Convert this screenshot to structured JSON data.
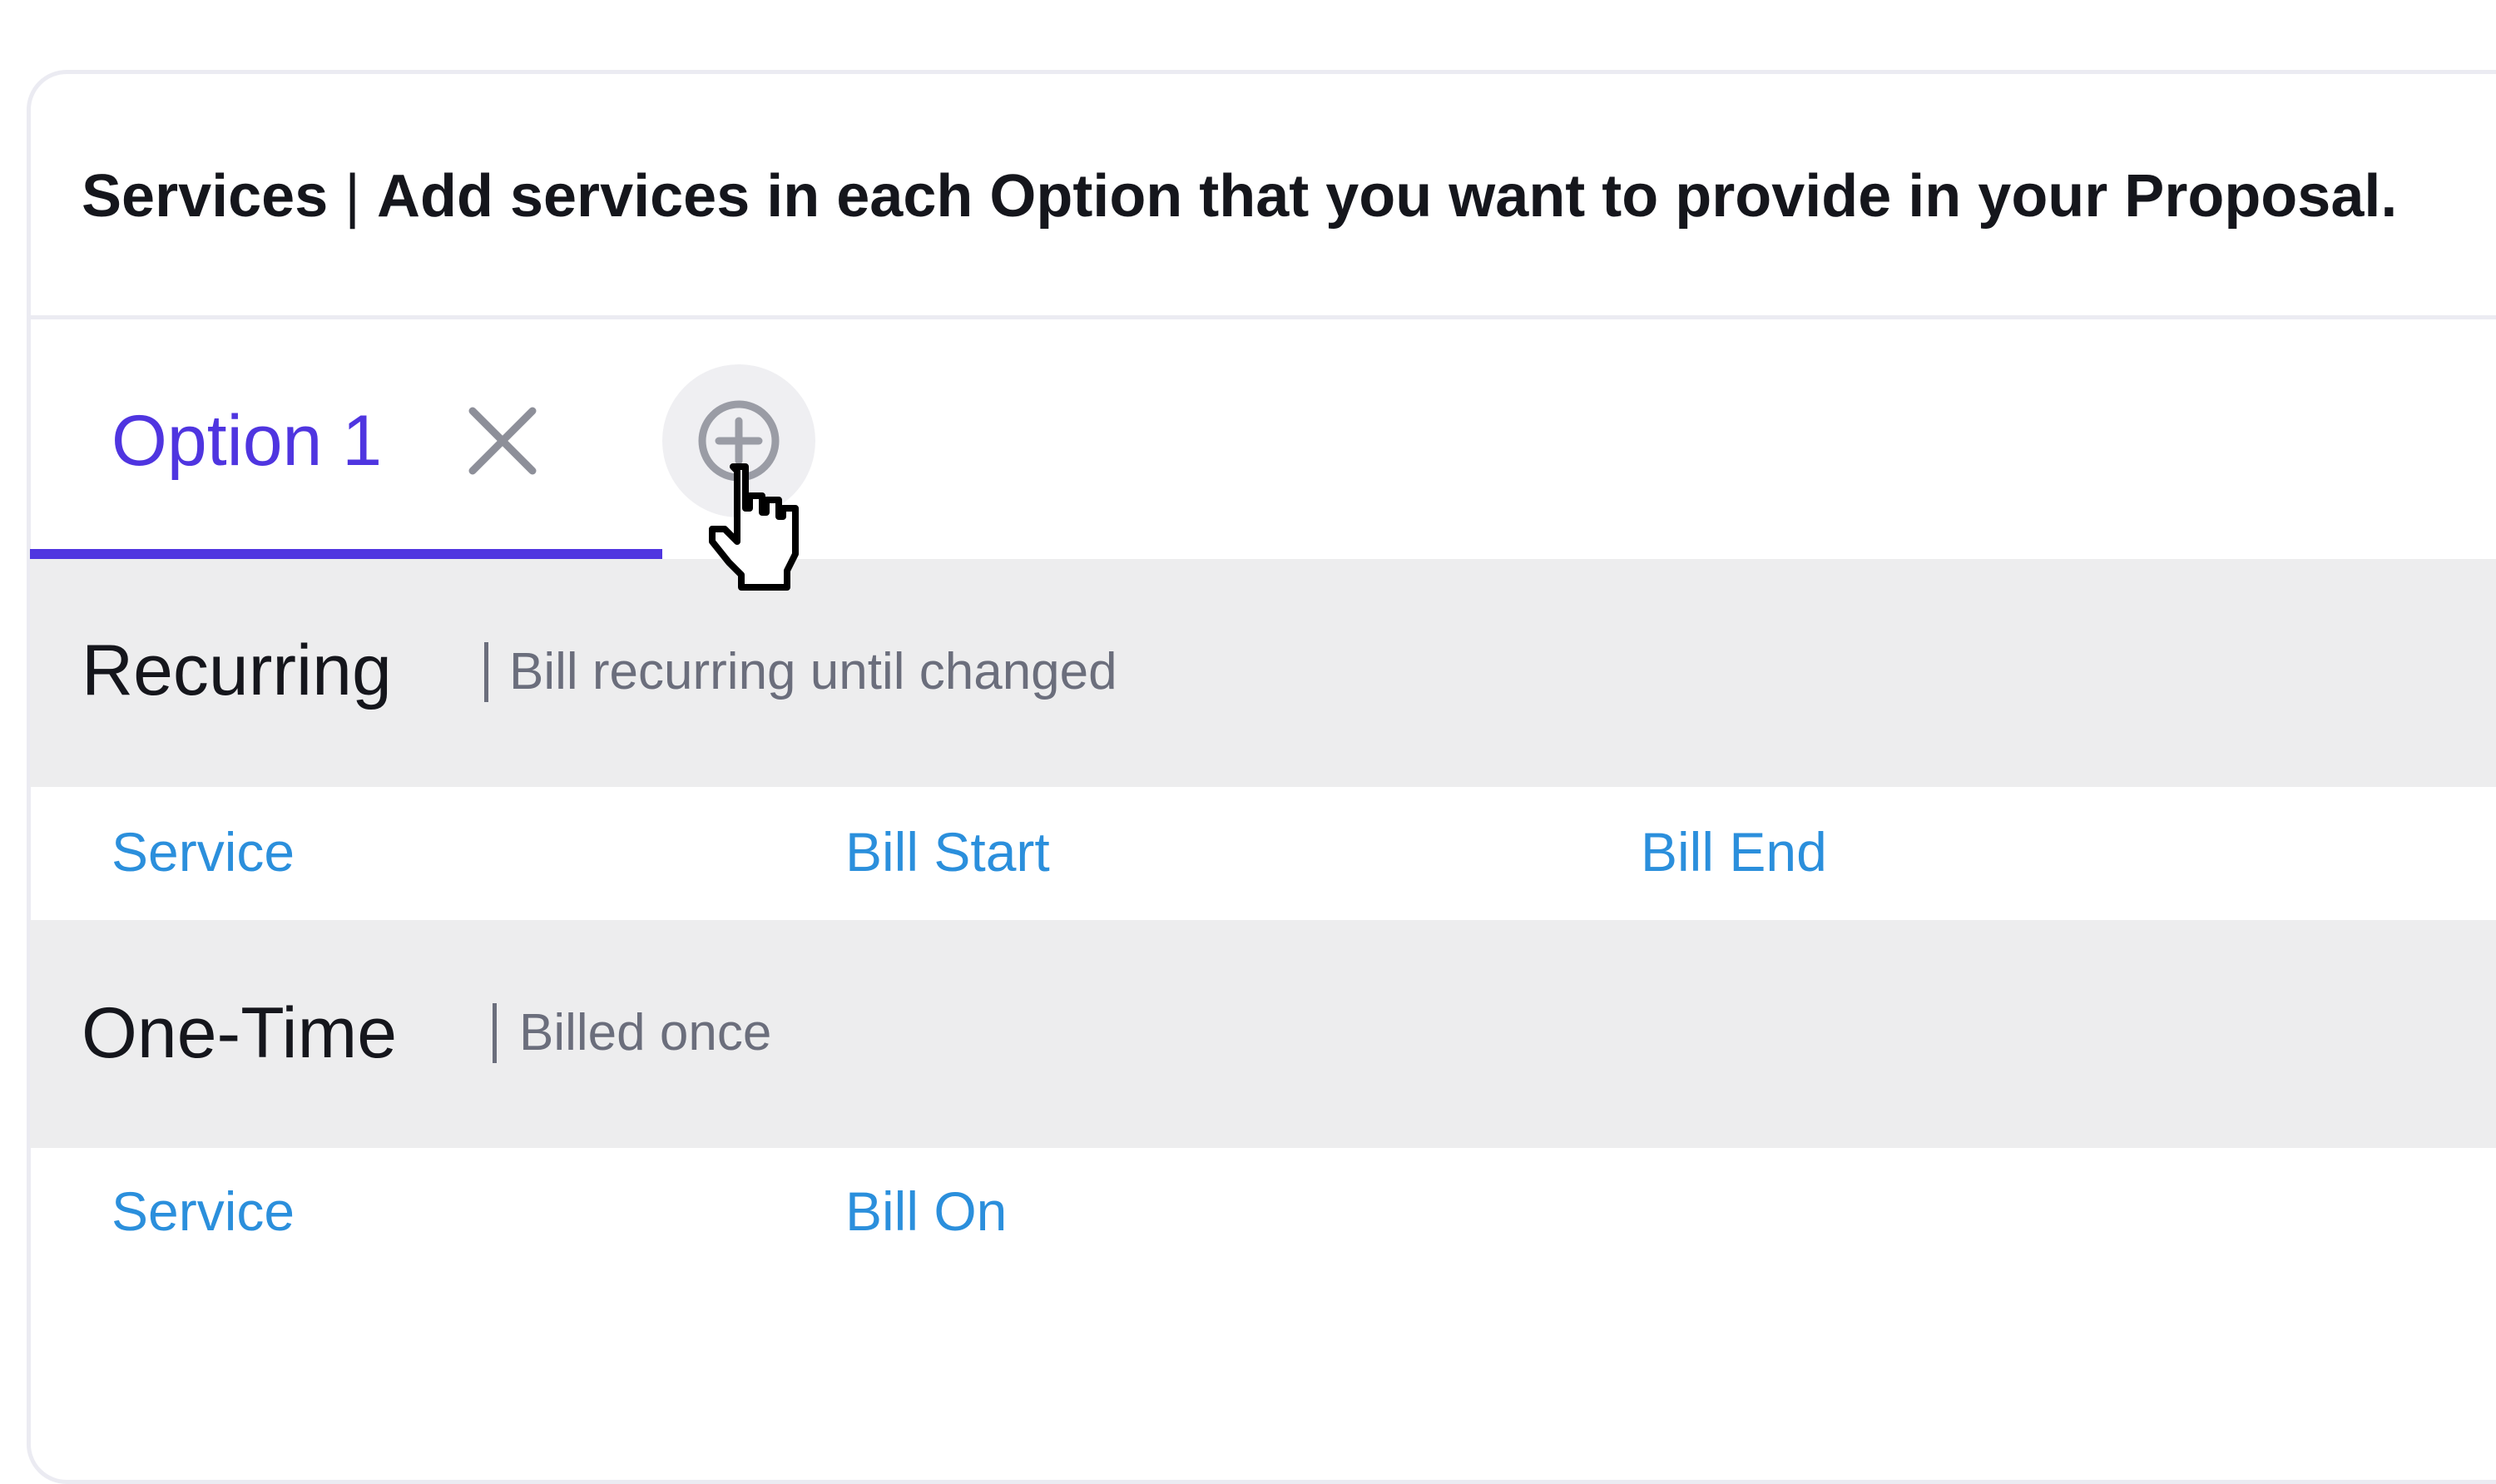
{
  "header": {
    "title": "Services",
    "separator": "|",
    "description": "Add services in each Option that you want to provide in your Proposal."
  },
  "tabs": [
    {
      "label": "Option 1",
      "active": true,
      "close_icon": "close-icon"
    }
  ],
  "add_tab_icon": "plus-circle-icon",
  "sections": {
    "recurring": {
      "title": "Recurring",
      "subtitle": "Bill recurring until changed",
      "columns": [
        "Service",
        "Bill Start",
        "Bill End"
      ]
    },
    "one_time": {
      "title": "One-Time",
      "subtitle": "Billed once",
      "columns": [
        "Service",
        "Bill On"
      ]
    }
  },
  "colors": {
    "accent": "#4f35e0",
    "link": "#2b8fdc",
    "band": "#ededee",
    "border": "#ebebf2",
    "muted_text": "#6b6e7c"
  }
}
